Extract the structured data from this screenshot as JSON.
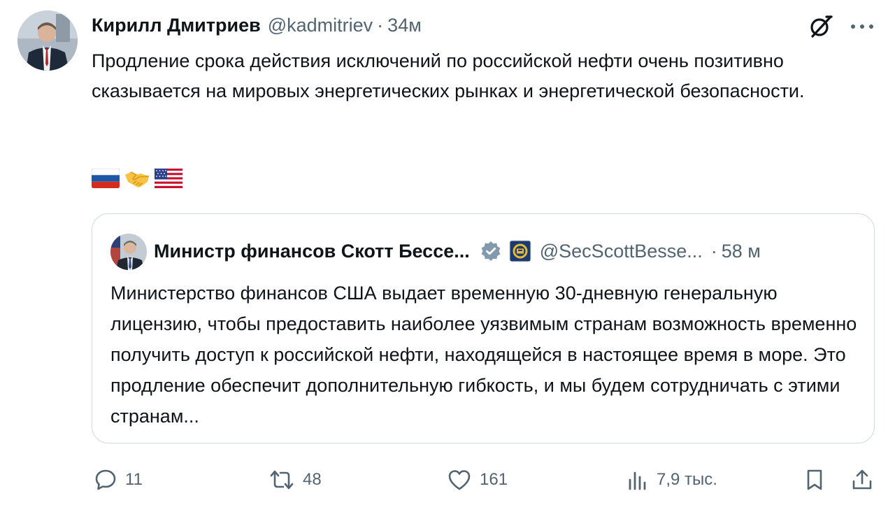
{
  "colors": {
    "text": "#0f1419",
    "secondary": "#536471",
    "border": "#cfd9de",
    "verified_badge": "#829aab"
  },
  "tweet": {
    "author_name": "Кирилл Дмитриев",
    "author_handle": "@kadmitriev",
    "separator": "·",
    "time": "34м",
    "text": "Продление срока действия исключений по российской нефти очень позитивно сказывается на мировых энергетических рынках и энергетической безопасности.",
    "emojis": [
      "flag-russia",
      "handshake",
      "flag-usa"
    ]
  },
  "quote": {
    "author_name": "Министр финансов Скотт Бессе...",
    "author_handle": "@SecScottBesse...",
    "separator": "·",
    "time": "58 м",
    "text": "Министерство финансов США выдает временную 30-дневную генеральную лицензию, чтобы предоставить наиболее уязвимым странам возможность временно получить доступ к российской нефти, находящейся в настоящее время в море. Это продление обеспечит дополнительную гибкость, и мы будем сотрудничать с этими странам..."
  },
  "actions": {
    "replies": "11",
    "reposts": "48",
    "likes": "161",
    "views": "7,9 тыс."
  },
  "icons": [
    "grok-icon",
    "more-icon",
    "verified-badge-icon",
    "treasury-seal-icon",
    "reply-icon",
    "repost-icon",
    "like-icon",
    "views-icon",
    "bookmark-icon",
    "share-icon"
  ]
}
